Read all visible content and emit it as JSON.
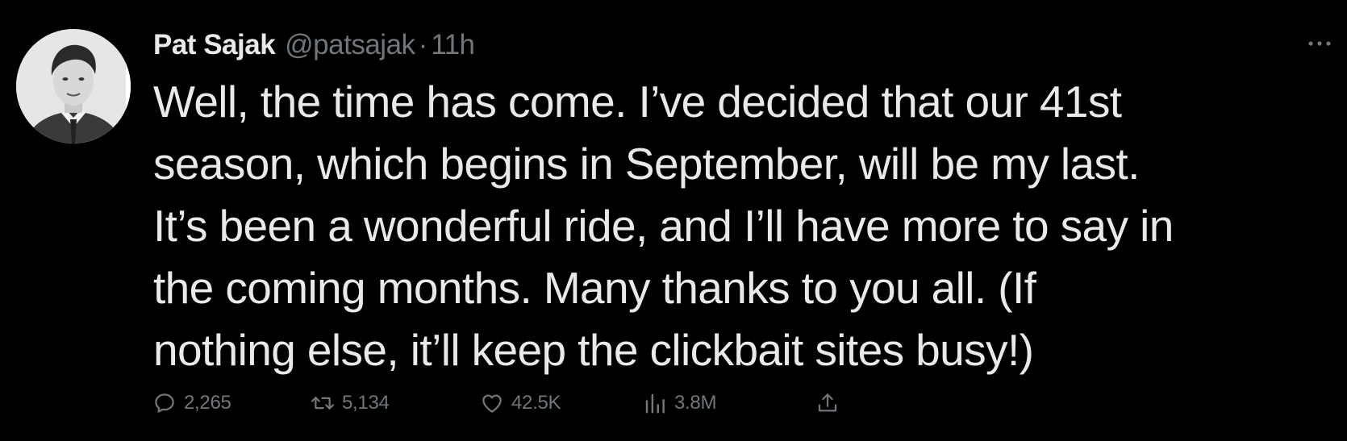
{
  "tweet": {
    "author": {
      "display_name": "Pat Sajak",
      "handle": "@patsajak",
      "separator": "·",
      "timestamp": "11h",
      "avatar_icon": "portrait-photo"
    },
    "text": "Well, the time has come. I’ve decided that our 41st\nseason, which begins in September, will be my last.\nIt’s been a wonderful ride, and I’ll have more to say in\nthe coming months. Many thanks to you all. (If\nnothing else, it’ll keep the clickbait sites busy!)",
    "actions": {
      "replies": "2,265",
      "retweets": "5,134",
      "likes": "42.5K",
      "views": "3.8M"
    }
  },
  "colors": {
    "background": "#000000",
    "primary_text": "#e7e9ea",
    "secondary_text": "#71767b"
  }
}
